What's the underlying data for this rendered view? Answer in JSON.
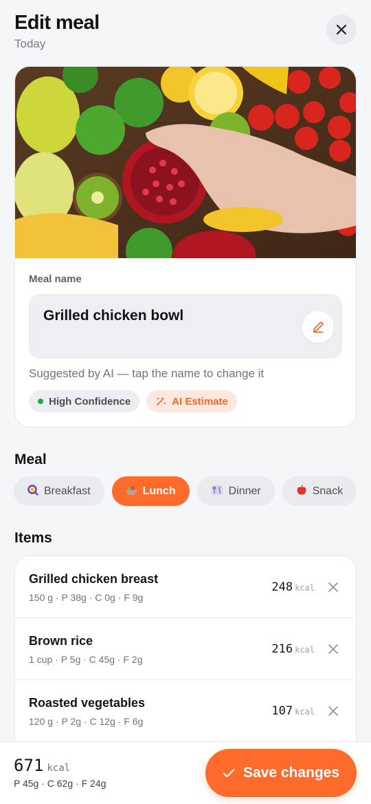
{
  "header": {
    "title": "Edit meal",
    "subtitle": "Today",
    "close_icon": "close-icon"
  },
  "photo": {
    "description_icon": "meal-photo"
  },
  "meal_name": {
    "label": "Meal name",
    "value": "Grilled chicken bowl",
    "edit_icon": "pencil-icon",
    "hint": "Suggested by AI — tap the name to change it"
  },
  "badges": {
    "confidence": "High Confidence",
    "confidence_color": "#1fa855",
    "ai": "AI Estimate",
    "ai_color": "#f06a2c"
  },
  "meal_section": {
    "title": "Meal",
    "options": [
      {
        "label": "Breakfast",
        "icon": "🍳",
        "active": false
      },
      {
        "label": "Lunch",
        "icon": "🥗",
        "active": true
      },
      {
        "label": "Dinner",
        "icon": "🍽",
        "active": false
      },
      {
        "label": "Snack",
        "icon": "🍎",
        "active": false
      }
    ]
  },
  "items_section": {
    "title": "Items",
    "kcal_unit": "kcal",
    "items": [
      {
        "name": "Grilled chicken breast",
        "meta": "150 g · P 38g · C 0g · F 9g",
        "kcal": "248"
      },
      {
        "name": "Brown rice",
        "meta": "1 cup · P 5g · C 45g · F 2g",
        "kcal": "216"
      },
      {
        "name": "Roasted vegetables",
        "meta": "120 g · P 2g · C 12g · F 6g",
        "kcal": "107"
      }
    ]
  },
  "footer": {
    "total_kcal": "671",
    "kcal_unit": "kcal",
    "macros": "P 45g · C 62g · F 24g",
    "save_label": "Save changes",
    "accent": "#ff6b2a"
  }
}
